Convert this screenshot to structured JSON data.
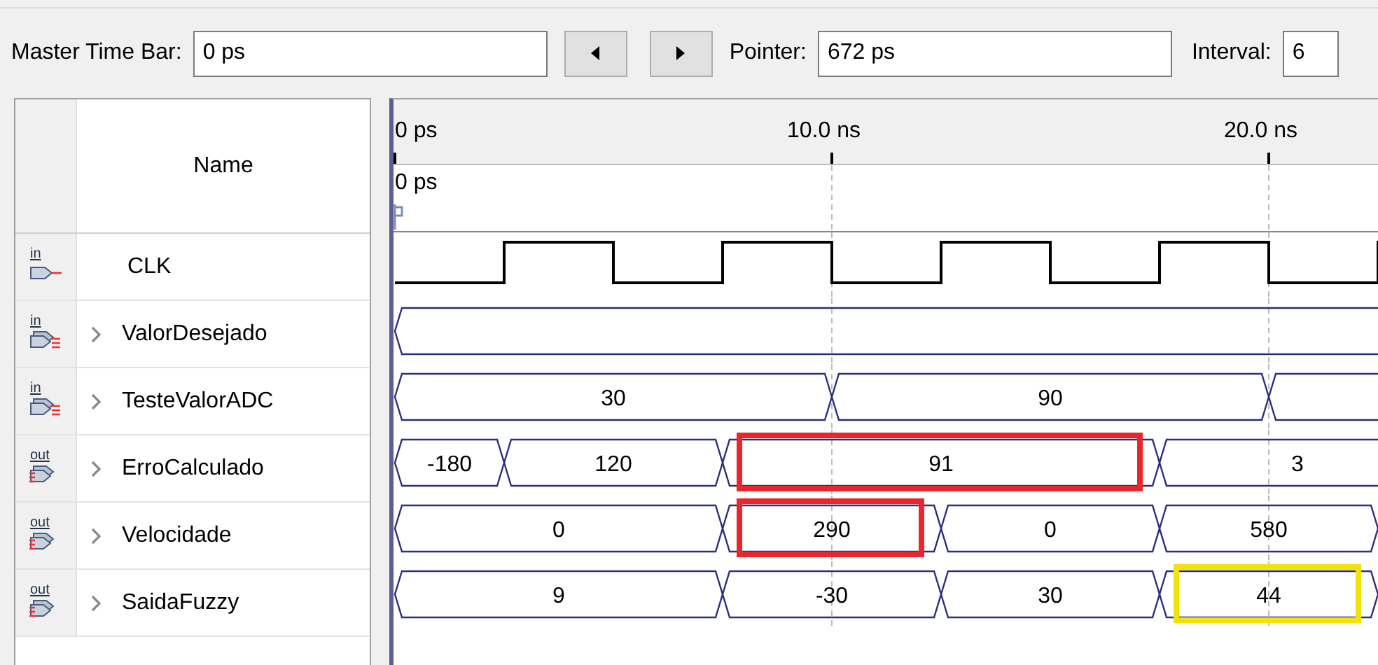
{
  "toolbar": {
    "master_time_bar": {
      "label": "Master Time Bar:",
      "value": "0 ps"
    },
    "pointer": {
      "label": "Pointer:",
      "value": "672 ps"
    },
    "interval": {
      "label": "Interval:",
      "value": "6"
    }
  },
  "signal_list": {
    "header": "Name"
  },
  "ruler": {
    "ticks": [
      {
        "label": "0 ps"
      },
      {
        "label": "10.0 ns"
      },
      {
        "label": "20.0 ns"
      }
    ],
    "time_bar": {
      "label": "0 ps"
    }
  },
  "signals": [
    {
      "name": "CLK",
      "direction": "in",
      "kind": "bit"
    },
    {
      "name": "ValorDesejado",
      "direction": "in",
      "kind": "bus",
      "expanded": false
    },
    {
      "name": "TesteValorADC",
      "direction": "in",
      "kind": "bus",
      "expanded": false,
      "waveform": [
        {
          "value": "30"
        },
        {
          "value": "90"
        }
      ]
    },
    {
      "name": "ErroCalculado",
      "direction": "out",
      "kind": "bus",
      "expanded": false,
      "waveform": [
        {
          "value": "-180"
        },
        {
          "value": "120"
        },
        {
          "value": "91",
          "highlight": {
            "color": "#e8262b"
          }
        },
        {
          "value": "3"
        }
      ]
    },
    {
      "name": "Velocidade",
      "direction": "out",
      "kind": "bus",
      "expanded": false,
      "waveform": [
        {
          "value": "0"
        },
        {
          "value": "290",
          "highlight": {
            "color": "#e8262b"
          }
        },
        {
          "value": "0"
        },
        {
          "value": "580"
        }
      ]
    },
    {
      "name": "SaidaFuzzy",
      "direction": "out",
      "kind": "bus",
      "expanded": false,
      "waveform": [
        {
          "value": "9"
        },
        {
          "value": "-30"
        },
        {
          "value": "30"
        },
        {
          "value": "44",
          "highlight": {
            "color": "#f2e20a"
          }
        }
      ]
    }
  ]
}
